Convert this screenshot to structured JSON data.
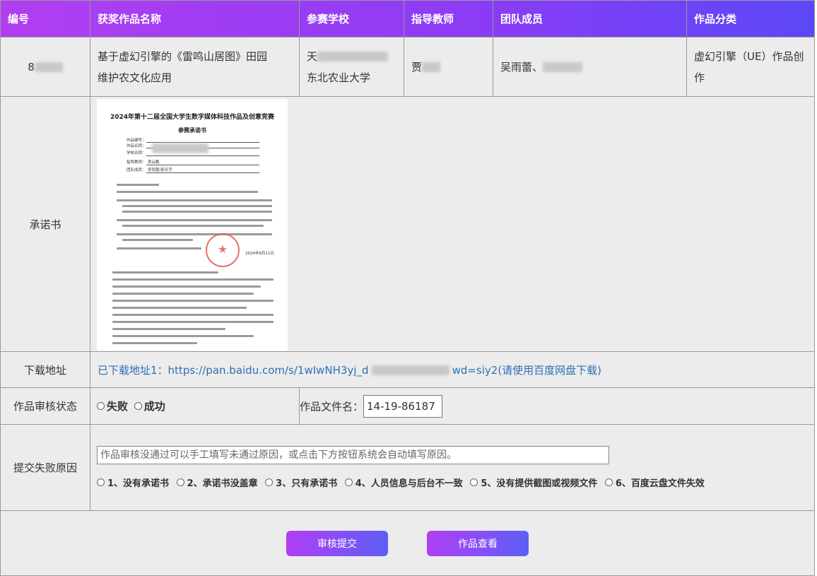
{
  "header": {
    "col_id": "编号",
    "col_name": "获奖作品名称",
    "col_school": "参赛学校",
    "col_teacher": "指导教师",
    "col_team": "团队成员",
    "col_category": "作品分类"
  },
  "row": {
    "id": "8",
    "name_line1": "基于虚幻引擎的《雷鸣山居图》田园",
    "name_line2": "维护农文化应用",
    "school_line1": "天",
    "school_line2": "东北农业大学",
    "teacher": "贾",
    "team": "吴雨蕾、",
    "category": "虚幻引擎（UE）作品创作"
  },
  "commitment": {
    "label": "承诺书",
    "doc_title": "2024年第十二届全国大学生数字媒体科技作品及创意竞赛",
    "doc_subtitle": "参赛承诺书",
    "doc_date": "2024年8月11日",
    "field_code": "作品编号：",
    "field_name": "作品名称：",
    "field_school": "学校名称：",
    "field_teacher": "指导教师：",
    "field_team": "团队成员：",
    "teacher_val": "贾云鹏",
    "team_val": "吴雨蕾/郭天宇",
    "seal_glyph": "★"
  },
  "download": {
    "label": "下载地址",
    "text": "已下载地址1：https://pan.baidu.com/s/1wIwNH3yj_d",
    "text_tail": "wd=siy2(请使用百度网盘下载)"
  },
  "review": {
    "label": "作品审核状态",
    "opt_fail": "失败",
    "opt_success": "成功",
    "filename_label": "作品文件名：",
    "filename_value": "14-19-86187"
  },
  "reason": {
    "label": "提交失败原因",
    "placeholder": "作品审核没通过可以手工填写未通过原因，或点击下方按钮系统会自动填写原因。",
    "options": [
      "1、没有承诺书",
      "2、承诺书没盖章",
      "3、只有承诺书",
      "4、人员信息与后台不一致",
      "5、没有提供截图或视频文件",
      "6、百度云盘文件失效"
    ]
  },
  "actions": {
    "submit": "审核提交",
    "view": "作品查看"
  },
  "colors": {
    "header_gradient_start": "#b23ef1",
    "header_gradient_end": "#5b48f7",
    "link": "#2d6fb4"
  }
}
